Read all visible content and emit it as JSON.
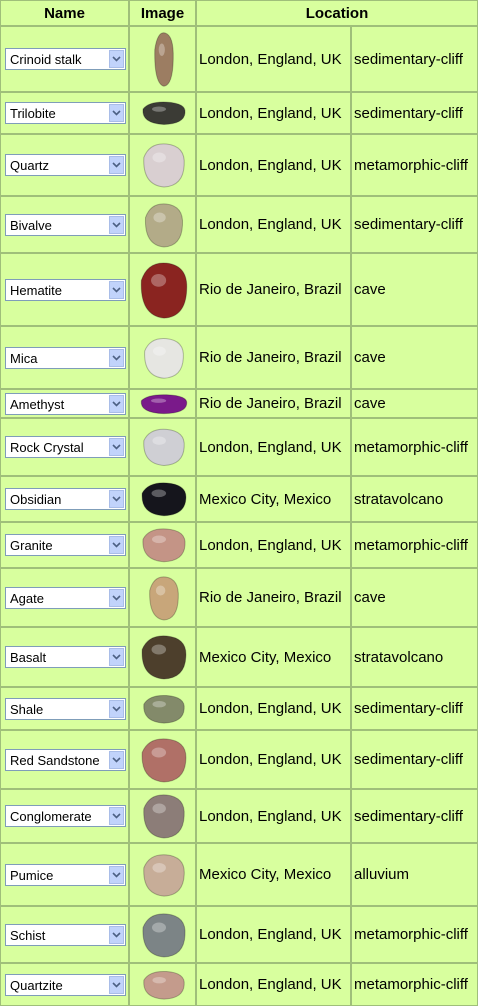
{
  "header": {
    "name": "Name",
    "image": "Image",
    "location": "Location"
  },
  "rows": [
    {
      "name": "Crinoid stalk",
      "city": "London, England, UK",
      "env": "sedimentary-cliff",
      "icon": "crinoid-stalk-image",
      "color": "#9c7d62"
    },
    {
      "name": "Trilobite",
      "city": "London, England, UK",
      "env": "sedimentary-cliff",
      "icon": "trilobite-image",
      "color": "#3b3b35"
    },
    {
      "name": "Quartz",
      "city": "London, England, UK",
      "env": "metamorphic-cliff",
      "icon": "quartz-image",
      "color": "#d9cfd1"
    },
    {
      "name": "Bivalve",
      "city": "London, England, UK",
      "env": "sedimentary-cliff",
      "icon": "bivalve-image",
      "color": "#b3ab88"
    },
    {
      "name": "Hematite",
      "city": "Rio de Janeiro, Brazil",
      "env": "cave",
      "icon": "hematite-image",
      "color": "#8a2420"
    },
    {
      "name": "Mica",
      "city": "Rio de Janeiro, Brazil",
      "env": "cave",
      "icon": "mica-image",
      "color": "#e6e6e2"
    },
    {
      "name": "Amethyst",
      "city": "Rio de Janeiro, Brazil",
      "env": "cave",
      "icon": "amethyst-image",
      "color": "#7a1a8a"
    },
    {
      "name": "Rock Crystal",
      "city": "London, England, UK",
      "env": "metamorphic-cliff",
      "icon": "rock-crystal-image",
      "color": "#cfcfd4"
    },
    {
      "name": "Obsidian",
      "city": "Mexico City, Mexico",
      "env": "stratavolcano",
      "icon": "obsidian-image",
      "color": "#15151c"
    },
    {
      "name": "Granite",
      "city": "London, England, UK",
      "env": "metamorphic-cliff",
      "icon": "granite-image",
      "color": "#c49486"
    },
    {
      "name": "Agate",
      "city": "Rio de Janeiro, Brazil",
      "env": "cave",
      "icon": "agate-image",
      "color": "#c8a67a"
    },
    {
      "name": "Basalt",
      "city": "Mexico City, Mexico",
      "env": "stratavolcano",
      "icon": "basalt-image",
      "color": "#4d3f2c"
    },
    {
      "name": "Shale",
      "city": "London, England, UK",
      "env": "sedimentary-cliff",
      "icon": "shale-image",
      "color": "#838a6a"
    },
    {
      "name": "Red Sandstone",
      "city": "London, England, UK",
      "env": "sedimentary-cliff",
      "icon": "red-sandstone-image",
      "color": "#b07067"
    },
    {
      "name": "Conglomerate",
      "city": "London, England, UK",
      "env": "sedimentary-cliff",
      "icon": "conglomerate-image",
      "color": "#8c7d78"
    },
    {
      "name": "Pumice",
      "city": "Mexico City, Mexico",
      "env": "alluvium",
      "icon": "pumice-image",
      "color": "#c7ad98"
    },
    {
      "name": "Schist",
      "city": "London, England, UK",
      "env": "metamorphic-cliff",
      "icon": "schist-image",
      "color": "#7c8486"
    },
    {
      "name": "Quartzite",
      "city": "London, England, UK",
      "env": "metamorphic-cliff",
      "icon": "quartzite-image",
      "color": "#c49b8c"
    }
  ]
}
